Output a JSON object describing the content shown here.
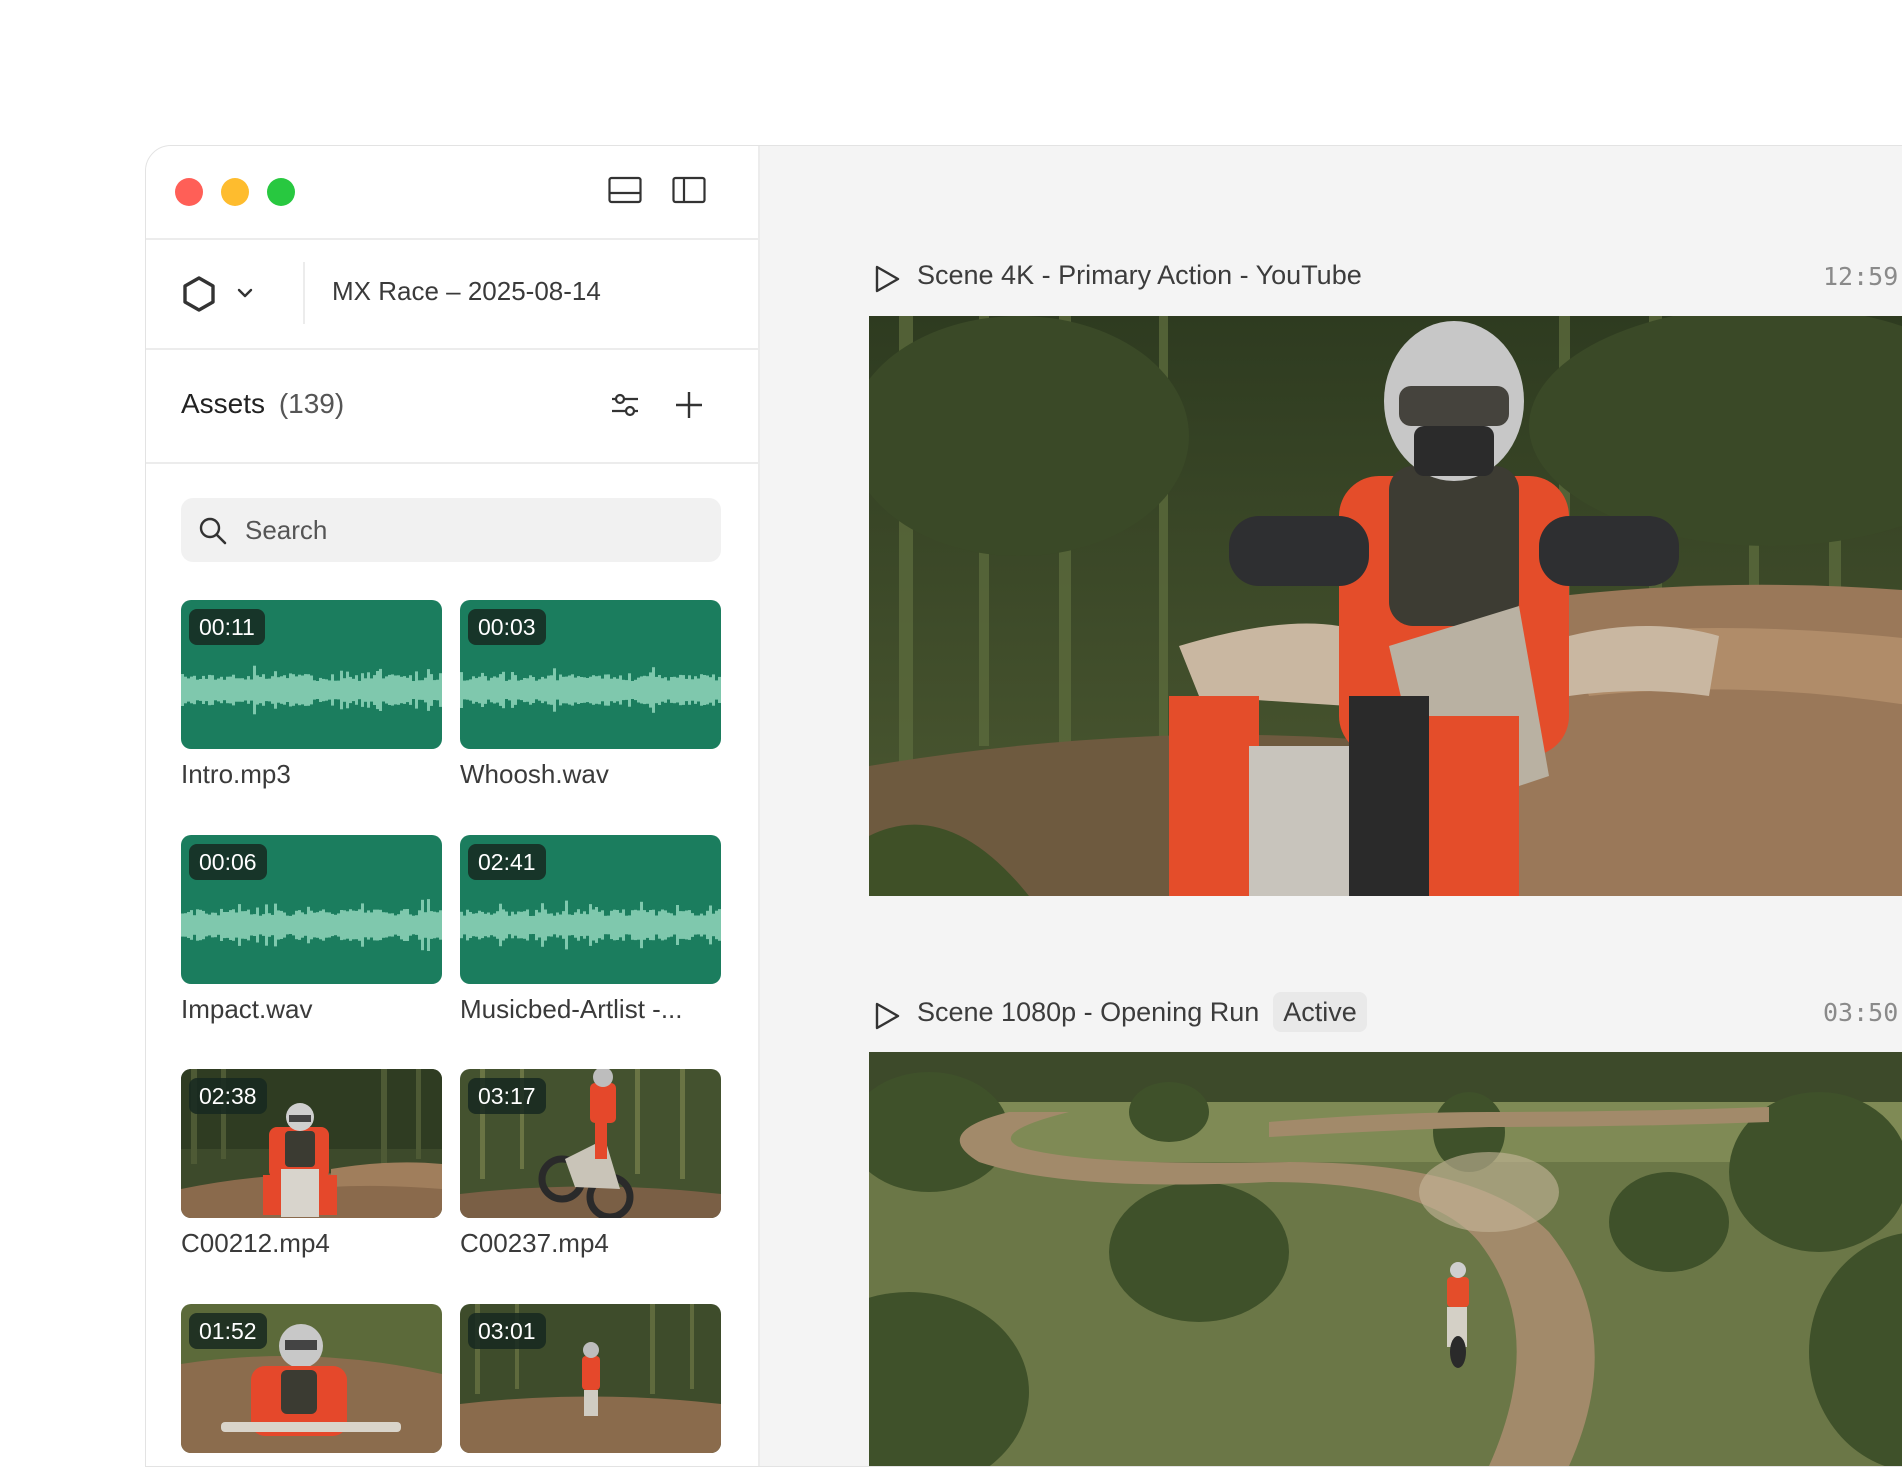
{
  "project": {
    "name": "MX Race – 2025-08-14"
  },
  "assets": {
    "title": "Assets",
    "count": "(139)",
    "search_placeholder": "Search",
    "items": [
      {
        "name": "Intro.mp3",
        "duration": "00:11",
        "kind": "audio"
      },
      {
        "name": "Whoosh.wav",
        "duration": "00:03",
        "kind": "audio"
      },
      {
        "name": "Impact.wav",
        "duration": "00:06",
        "kind": "audio"
      },
      {
        "name": "Musicbed-Artlist -...",
        "duration": "02:41",
        "kind": "audio"
      },
      {
        "name": "C00212.mp4",
        "duration": "02:38",
        "kind": "video"
      },
      {
        "name": "C00237.mp4",
        "duration": "03:17",
        "kind": "video"
      },
      {
        "name": "",
        "duration": "01:52",
        "kind": "video"
      },
      {
        "name": "",
        "duration": "03:01",
        "kind": "video"
      }
    ]
  },
  "scenes": [
    {
      "title": "Scene 4K - Primary Action - YouTube",
      "time": "12:59",
      "badge": ""
    },
    {
      "title": "Scene 1080p - Opening Run",
      "time": "03:50",
      "badge": "Active"
    }
  ],
  "colors": {
    "close": "#ff5f57",
    "minimize": "#febc2e",
    "maximize": "#28c840",
    "audio_thumb": "#1b7d5e",
    "waveform": "#7fc8ad"
  },
  "icons": {
    "logo": "hexagon-icon",
    "project_menu": "chevron-down-icon",
    "layout_bottom": "panel-bottom-icon",
    "layout_side": "panel-left-icon",
    "filter": "sliders-icon",
    "add": "plus-icon",
    "search": "search-icon",
    "play": "play-icon"
  }
}
